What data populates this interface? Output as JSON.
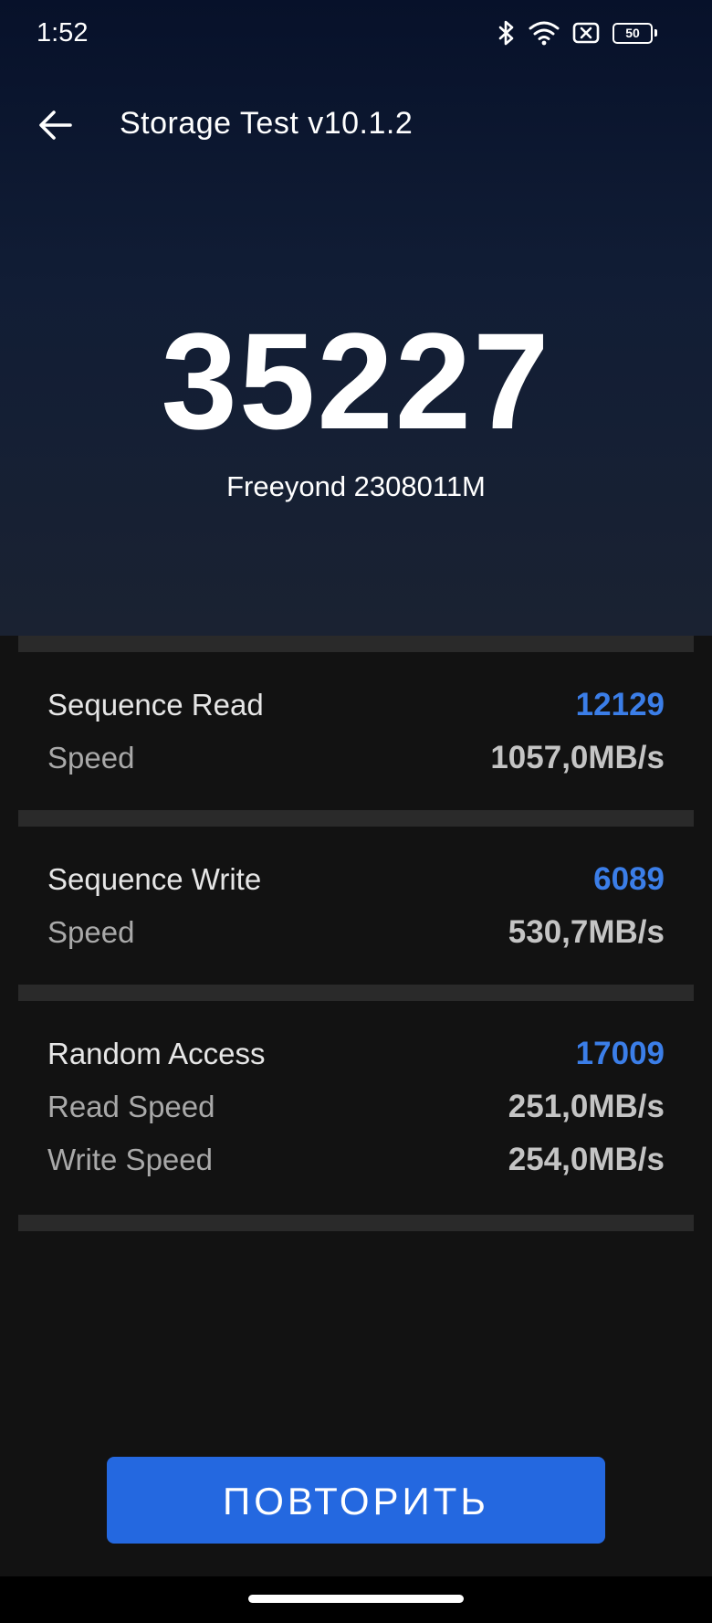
{
  "status_bar": {
    "time": "1:52",
    "battery_level": "50",
    "icons": [
      "bluetooth-icon",
      "wifi-icon",
      "sim-off-icon",
      "battery-icon"
    ]
  },
  "app_bar": {
    "title": "Storage Test v10.1.2",
    "back_icon": "arrow-left-icon"
  },
  "result": {
    "score": "35227",
    "device": "Freeyond 2308011M"
  },
  "sections": [
    {
      "title": "Sequence Read",
      "score": "12129",
      "metrics": [
        {
          "label": "Speed",
          "value": "1057,0MB/s"
        }
      ]
    },
    {
      "title": "Sequence Write",
      "score": "6089",
      "metrics": [
        {
          "label": "Speed",
          "value": "530,7MB/s"
        }
      ]
    },
    {
      "title": "Random Access",
      "score": "17009",
      "metrics": [
        {
          "label": "Read Speed",
          "value": "251,0MB/s"
        },
        {
          "label": "Write Speed",
          "value": "254,0MB/s"
        }
      ]
    }
  ],
  "actions": {
    "retry_label": "ПОВТОРИТЬ"
  },
  "colors": {
    "accent": "#2468e0",
    "score_blue": "#3b7ee8",
    "background": "#121212",
    "header_top": "#07112a"
  }
}
